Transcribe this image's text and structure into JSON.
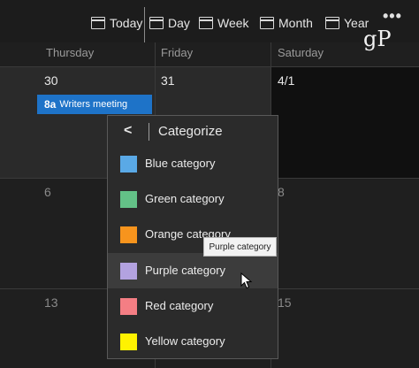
{
  "toolbar": {
    "today": "Today",
    "day": "Day",
    "week": "Week",
    "month": "Month",
    "year": "Year",
    "more": "•••",
    "logo": "gP"
  },
  "calendar": {
    "days": [
      "Thursday",
      "Friday",
      "Saturday"
    ],
    "row1_dates": [
      "30",
      "31",
      "4/1"
    ],
    "row2_dates": [
      "6",
      "8"
    ],
    "row3_dates": [
      "13",
      "15"
    ],
    "event": {
      "time": "8a",
      "title": "Writers meeting",
      "color": "#1e73c8"
    }
  },
  "menu": {
    "back": "<",
    "title": "Categorize",
    "items": [
      {
        "label": "Blue category",
        "color": "#5aa9e6"
      },
      {
        "label": "Green category",
        "color": "#63c187"
      },
      {
        "label": "Orange category",
        "color": "#f7941d"
      },
      {
        "label": "Purple category",
        "color": "#b3a2e0"
      },
      {
        "label": "Red category",
        "color": "#f47e84"
      },
      {
        "label": "Yellow category",
        "color": "#fff200"
      }
    ]
  },
  "tooltip": "Purple category"
}
